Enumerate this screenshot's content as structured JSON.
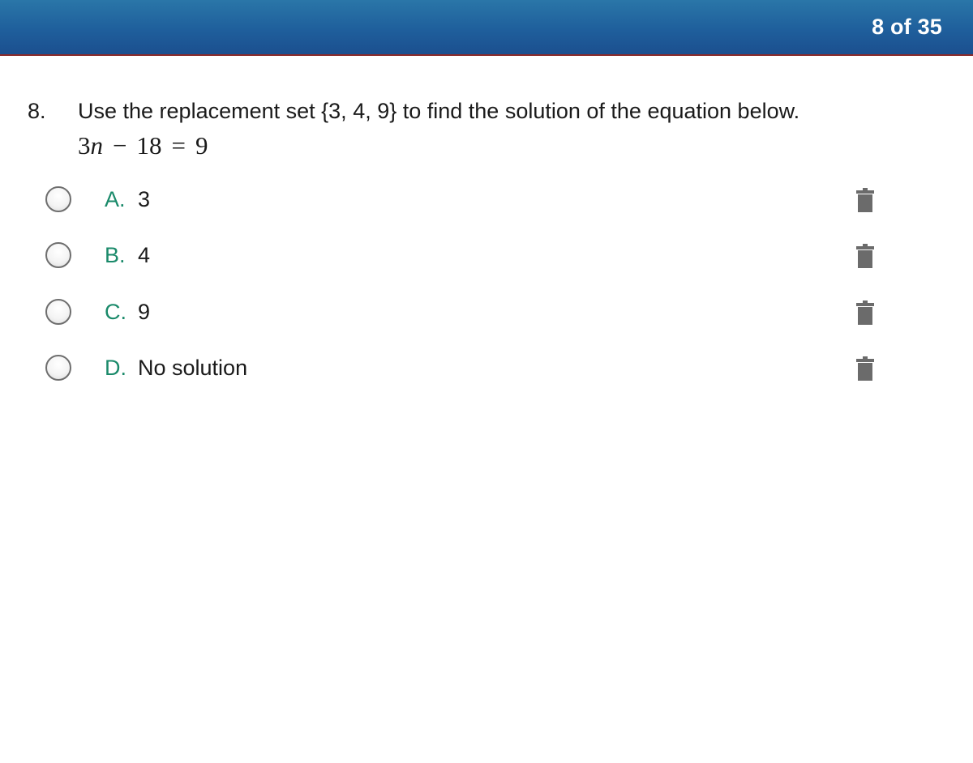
{
  "header": {
    "counter": "8 of 35"
  },
  "question": {
    "number": "8.",
    "text": "Use the replacement set {3, 4, 9} to find the solution of the equation below.",
    "equation": {
      "coef": "3",
      "var": "n",
      "op": "−",
      "const": "18",
      "eq": "=",
      "rhs": "9"
    }
  },
  "choices": [
    {
      "letter": "A.",
      "text": "3",
      "icon": "trash-icon"
    },
    {
      "letter": "B.",
      "text": "4",
      "icon": "trash-icon"
    },
    {
      "letter": "C.",
      "text": "9",
      "icon": "trash-icon"
    },
    {
      "letter": "D.",
      "text": "No solution",
      "icon": "trash-icon"
    }
  ],
  "colors": {
    "header_top": "#2a76a8",
    "header_bottom": "#1b4f8f",
    "header_border": "#8a2a2a",
    "choice_letter": "#1a8a6a",
    "icon": "#6b6b6b"
  }
}
